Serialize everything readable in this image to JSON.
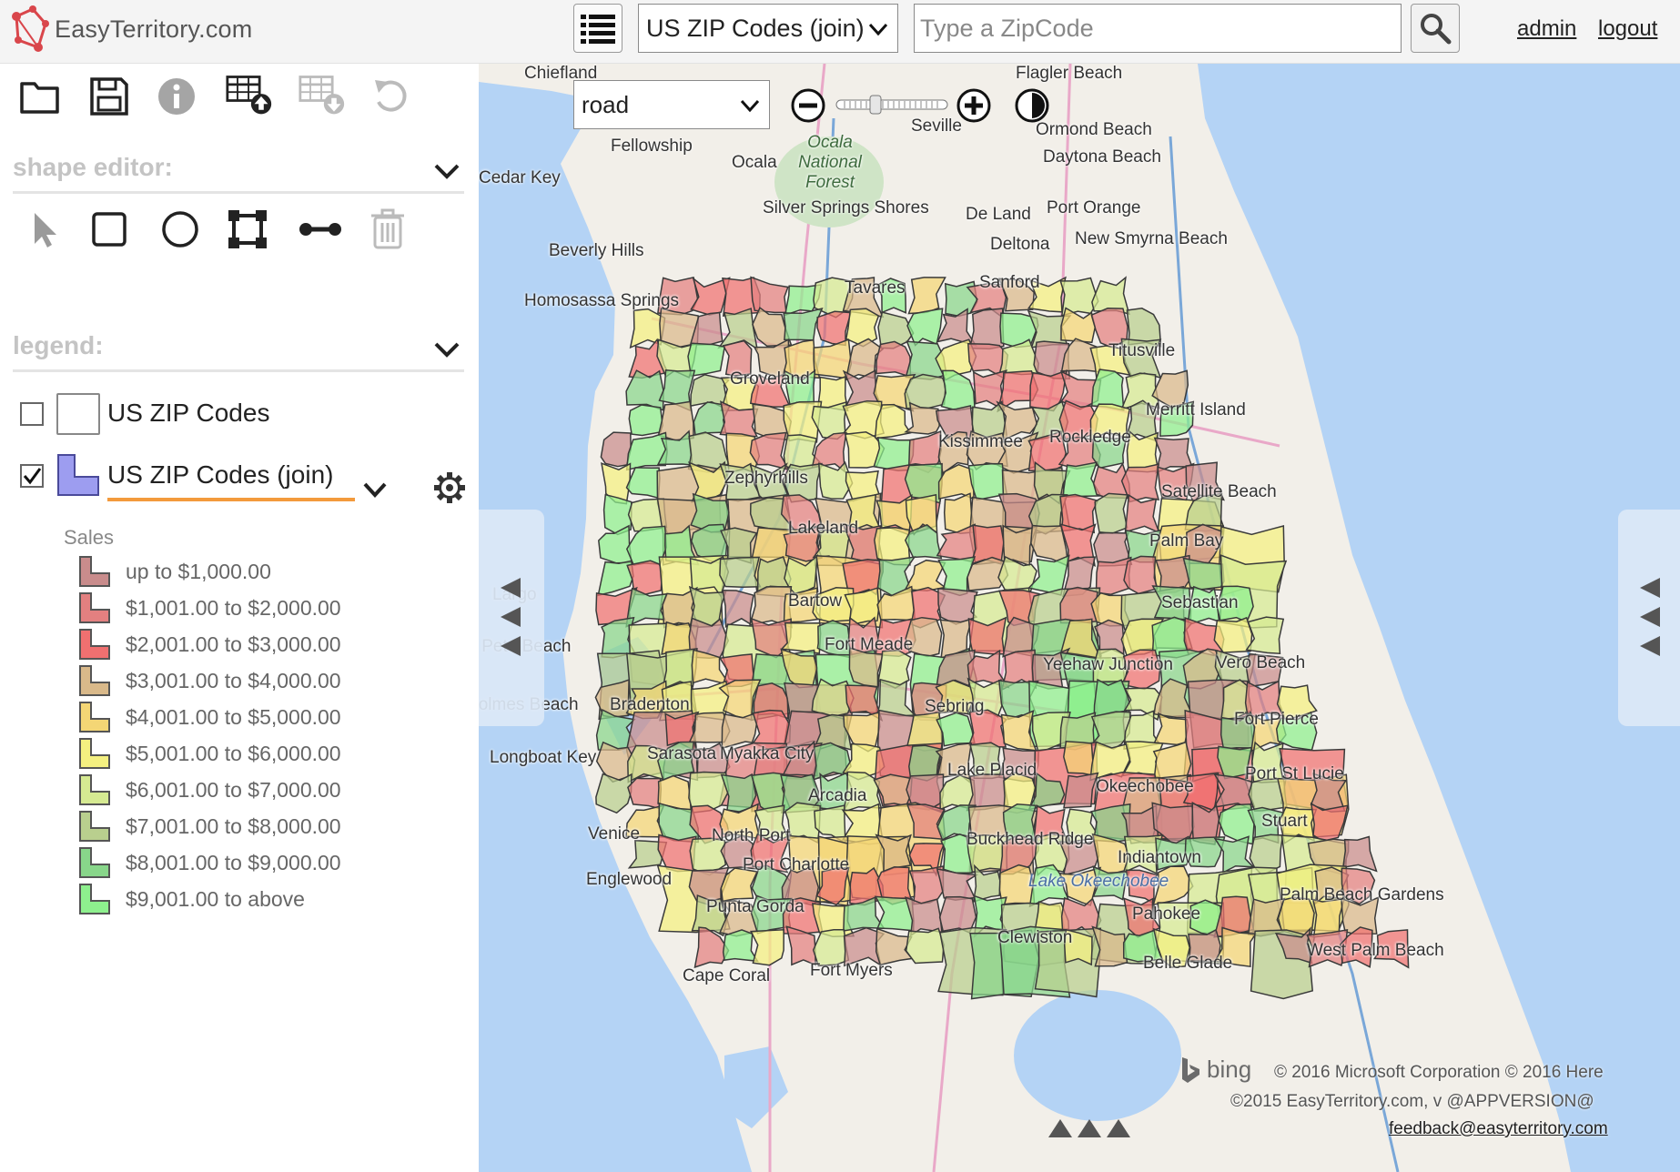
{
  "header": {
    "logo_text": "EasyTerritory.com",
    "layer_select_value": "US ZIP Codes (join)",
    "zip_placeholder": "Type a ZipCode",
    "admin_link": "admin",
    "logout_link": "logout"
  },
  "toolbar": {
    "icons": [
      "open-folder-icon",
      "save-icon",
      "info-icon",
      "table-upload-icon",
      "table-download-icon",
      "undo-icon"
    ]
  },
  "shape_editor": {
    "title": "shape editor:",
    "tools": [
      "select-arrow-icon",
      "rectangle-icon",
      "circle-icon",
      "polygon-icon",
      "line-icon",
      "trash-icon"
    ]
  },
  "legend": {
    "title": "legend:",
    "layers": [
      {
        "label": "US ZIP Codes",
        "checked": false
      },
      {
        "label": "US ZIP Codes (join)",
        "checked": true
      }
    ],
    "field_label": "Sales",
    "classes": [
      {
        "label": "up to $1,000.00",
        "color": "#c98c8c"
      },
      {
        "label": "$1,001.00 to $2,000.00",
        "color": "#e38080"
      },
      {
        "label": "$2,001.00 to $3,000.00",
        "color": "#f07070"
      },
      {
        "label": "$3,001.00 to $4,000.00",
        "color": "#d9b98a"
      },
      {
        "label": "$4,001.00 to $5,000.00",
        "color": "#f4d675"
      },
      {
        "label": "$5,001.00 to $6,000.00",
        "color": "#f4f080"
      },
      {
        "label": "$6,001.00 to $7,000.00",
        "color": "#d6ea92"
      },
      {
        "label": "$7,001.00 to $8,000.00",
        "color": "#b9cf8e"
      },
      {
        "label": "$8,001.00 to $9,000.00",
        "color": "#88d68a"
      },
      {
        "label": "$9,001.00 to above",
        "color": "#8ef08e"
      }
    ]
  },
  "map": {
    "style_value": "road",
    "places": [
      "Chiefland",
      "Flagler Beach",
      "Seville",
      "Ormond Beach",
      "Daytona Beach",
      "Fellowship",
      "Ocala",
      "Cedar Key",
      "Silver Springs Shores",
      "De Land",
      "Port Orange",
      "Deltona",
      "New Smyrna Beach",
      "Beverly Hills",
      "Sanford",
      "Homosassa Springs",
      "Tavares",
      "Titusville",
      "Groveland",
      "Merritt Island",
      "Kissimmee",
      "Rockledge",
      "Zephyrhills",
      "Satellite Beach",
      "Palm Bay",
      "Largo",
      "Lakeland",
      "Bartow",
      "Sebastian",
      "St Pete Beach",
      "Fort Meade",
      "Yeehaw Junction",
      "Vero Beach",
      "Holmes Beach",
      "Bradenton",
      "Sebring",
      "Fort Pierce",
      "Longboat Key",
      "Sarasota",
      "Myakka City",
      "Lake Placid",
      "Okeechobee",
      "Port St Lucie",
      "Arcadia",
      "Stuart",
      "Venice",
      "North Port",
      "Buckhead Ridge",
      "Port Charlotte",
      "Indiantown",
      "Englewood",
      "Punta Gorda",
      "Palm Beach Gardens",
      "Clewiston",
      "Pahokee",
      "Cape Coral",
      "Fort Myers",
      "West Palm Beach",
      "Belle Glade"
    ],
    "water_labels": [
      "Lake Okeechobee"
    ],
    "forest_label": "Ocala National Forest",
    "attribution": "bing",
    "copyright_1": "© 2016 Microsoft Corporation © 2016 Here",
    "copyright_2": "©2015 EasyTerritory.com, v @APPVERSION@",
    "feedback": "feedback@easyterritory.com"
  }
}
